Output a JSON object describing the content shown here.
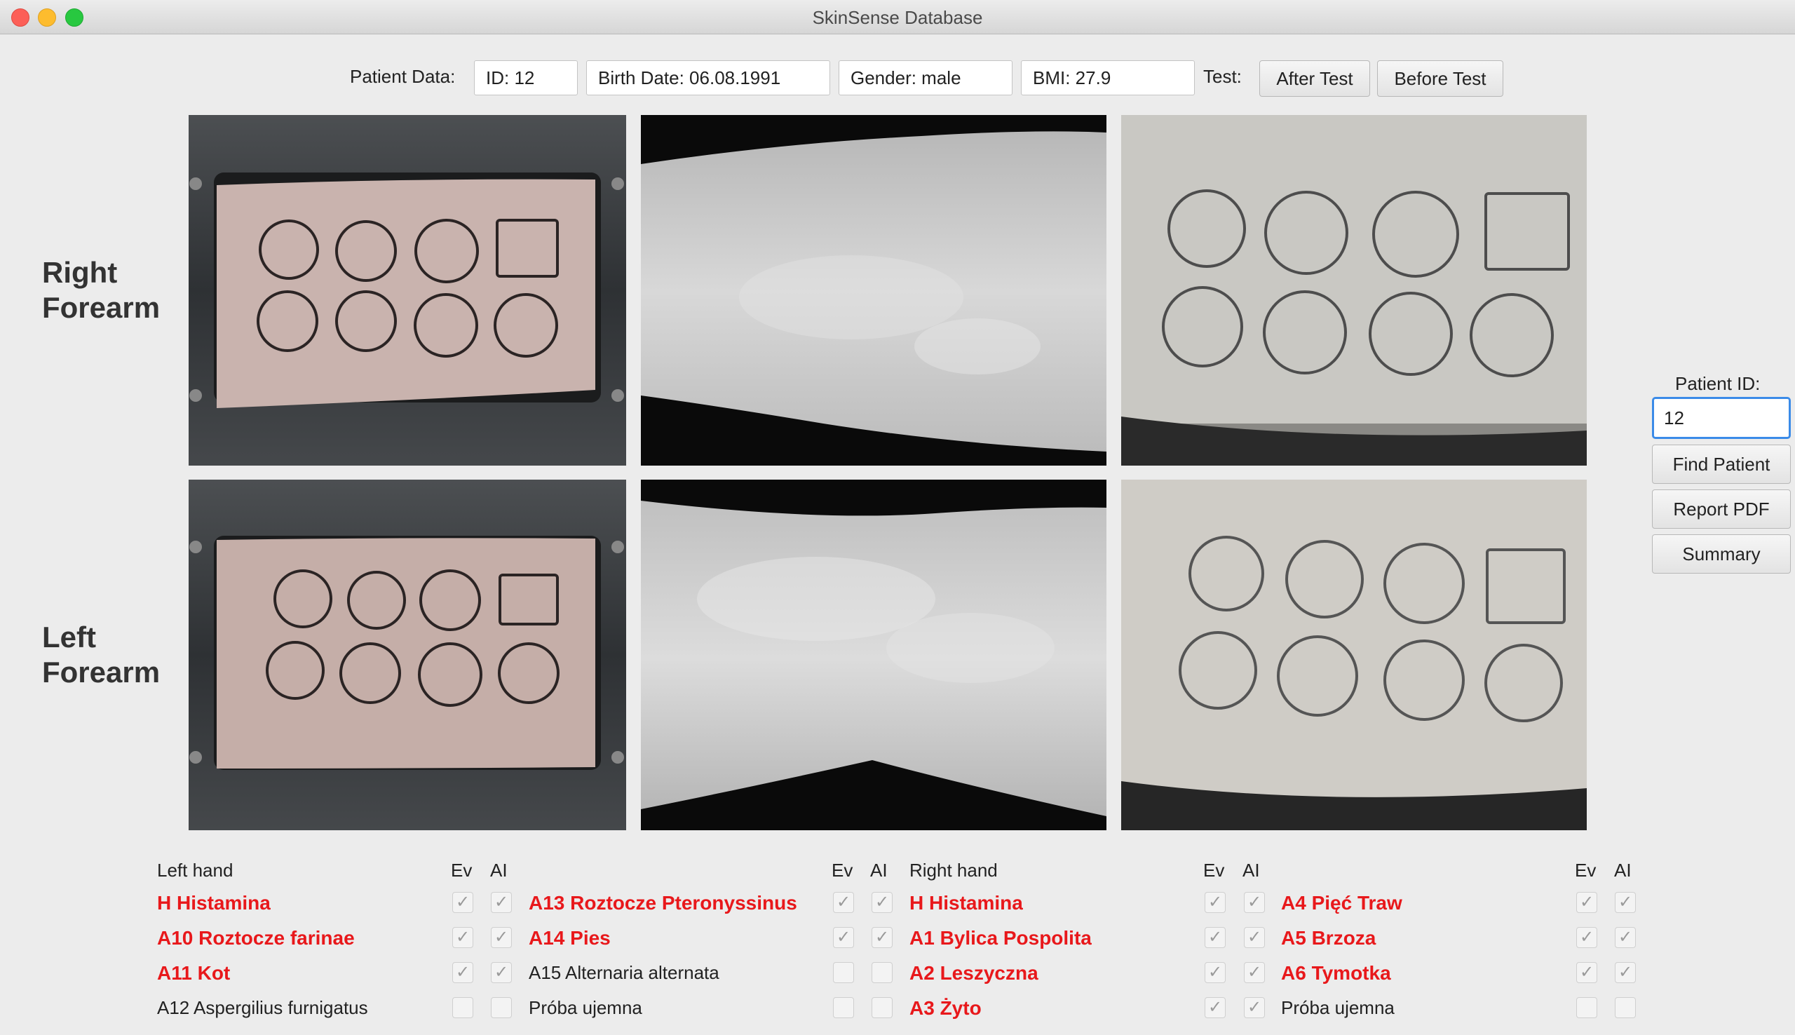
{
  "window": {
    "title": "SkinSense Database"
  },
  "header": {
    "patient_data_label": "Patient Data:",
    "id_value": "ID: 12",
    "birth_date_value": "Birth Date: 06.08.1991",
    "gender_value": "Gender: male",
    "bmi_value": "BMI: 27.9",
    "test_label": "Test:",
    "after_test_label": "After Test",
    "before_test_label": "Before Test"
  },
  "rows": {
    "right": {
      "line1": "Right",
      "line2": "Forearm"
    },
    "left": {
      "line1": "Left",
      "line2": "Forearm"
    }
  },
  "sidebar": {
    "patient_id_label": "Patient ID:",
    "patient_id_value": "12",
    "find_patient_label": "Find Patient",
    "report_pdf_label": "Report PDF",
    "summary_label": "Summary"
  },
  "checklist": {
    "left_hand_header": "Left hand",
    "right_hand_header": "Right hand",
    "ev_label": "Ev",
    "ai_label": "AI",
    "check_glyph": "✓",
    "columns": [
      [
        {
          "label": "H Histamina",
          "positive": true,
          "ev": true,
          "ai": true
        },
        {
          "label": "A10 Roztocze farinae",
          "positive": true,
          "ev": true,
          "ai": true
        },
        {
          "label": "A11 Kot",
          "positive": true,
          "ev": true,
          "ai": true
        },
        {
          "label": "A12 Aspergilius furnigatus",
          "positive": false,
          "ev": false,
          "ai": false
        }
      ],
      [
        {
          "label": "A13 Roztocze Pteronyssinus",
          "positive": true,
          "ev": true,
          "ai": true
        },
        {
          "label": "A14 Pies",
          "positive": true,
          "ev": true,
          "ai": true
        },
        {
          "label": "A15 Alternaria alternata",
          "positive": false,
          "ev": false,
          "ai": false
        },
        {
          "label": "Próba ujemna",
          "positive": false,
          "ev": false,
          "ai": false
        }
      ],
      [
        {
          "label": "H Histamina",
          "positive": true,
          "ev": true,
          "ai": true
        },
        {
          "label": "A1 Bylica Pospolita",
          "positive": true,
          "ev": true,
          "ai": true
        },
        {
          "label": "A2 Leszyczna",
          "positive": true,
          "ev": true,
          "ai": true
        },
        {
          "label": "A3 Żyto",
          "positive": true,
          "ev": true,
          "ai": true
        }
      ],
      [
        {
          "label": "A4 Pięć Traw",
          "positive": true,
          "ev": true,
          "ai": true
        },
        {
          "label": "A5 Brzoza",
          "positive": true,
          "ev": true,
          "ai": true
        },
        {
          "label": "A6 Tymotka",
          "positive": true,
          "ev": true,
          "ai": true
        },
        {
          "label": "Próba ujemna",
          "positive": false,
          "ev": false,
          "ai": false
        }
      ]
    ]
  },
  "colors": {
    "positive": "#e8181b",
    "focus": "#3b8be8"
  }
}
